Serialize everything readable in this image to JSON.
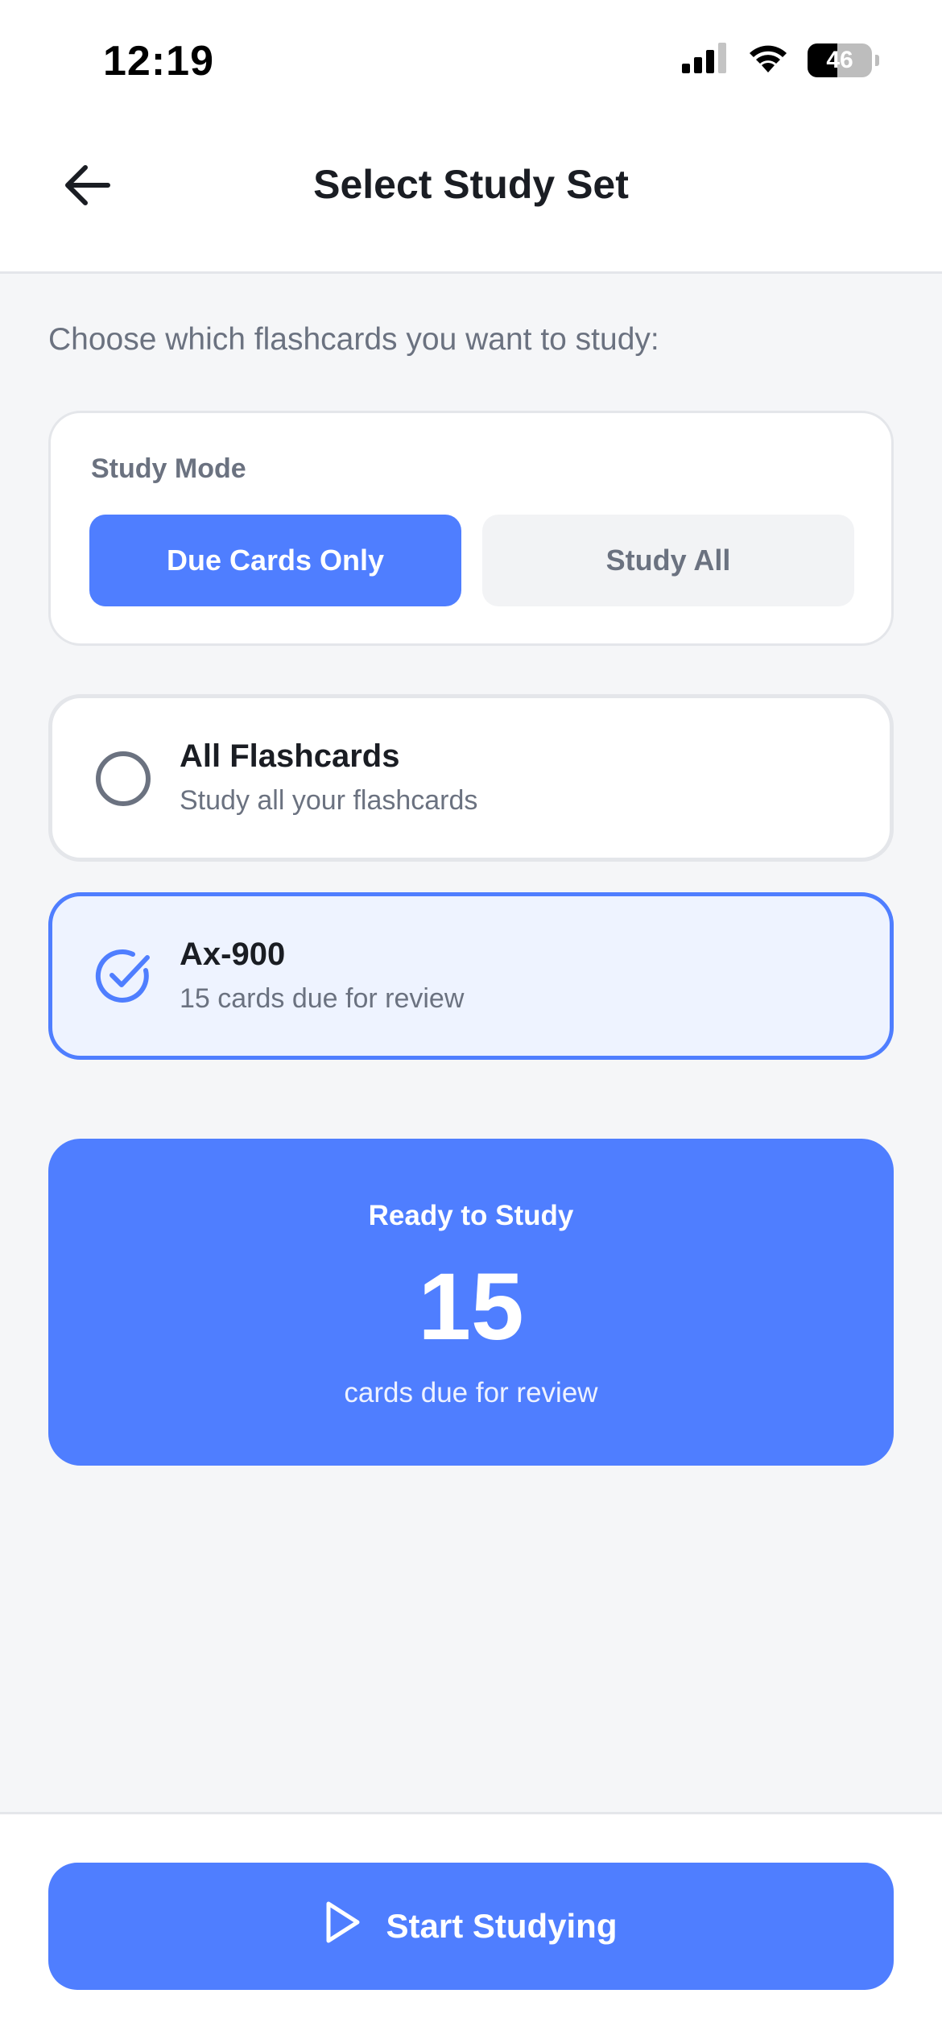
{
  "status_bar": {
    "time": "12:19",
    "battery_level": "46",
    "icons": [
      "cellular-signal-icon",
      "wifi-icon",
      "battery-icon"
    ]
  },
  "header": {
    "back_icon": "arrow-left-icon",
    "title": "Select Study Set"
  },
  "instruction": "Choose which flashcards you want to study:",
  "study_mode": {
    "label": "Study Mode",
    "options": [
      {
        "label": "Due Cards Only",
        "selected": true
      },
      {
        "label": "Study All",
        "selected": false
      }
    ]
  },
  "sets": [
    {
      "title": "All Flashcards",
      "subtitle": "Study all your flashcards",
      "selected": false,
      "icon": "radio-empty-icon"
    },
    {
      "title": "Ax-900",
      "subtitle": "15 cards due for review",
      "selected": true,
      "icon": "check-circle-icon"
    }
  ],
  "summary": {
    "title": "Ready to Study",
    "count": "15",
    "subtitle": "cards due for review"
  },
  "start_button": {
    "label": "Start Studying",
    "icon": "play-icon"
  },
  "colors": {
    "accent": "#4f7eff",
    "selected_bg": "#eef3ff",
    "muted_text": "#6b7280",
    "page_bg": "#f5f6f8"
  }
}
